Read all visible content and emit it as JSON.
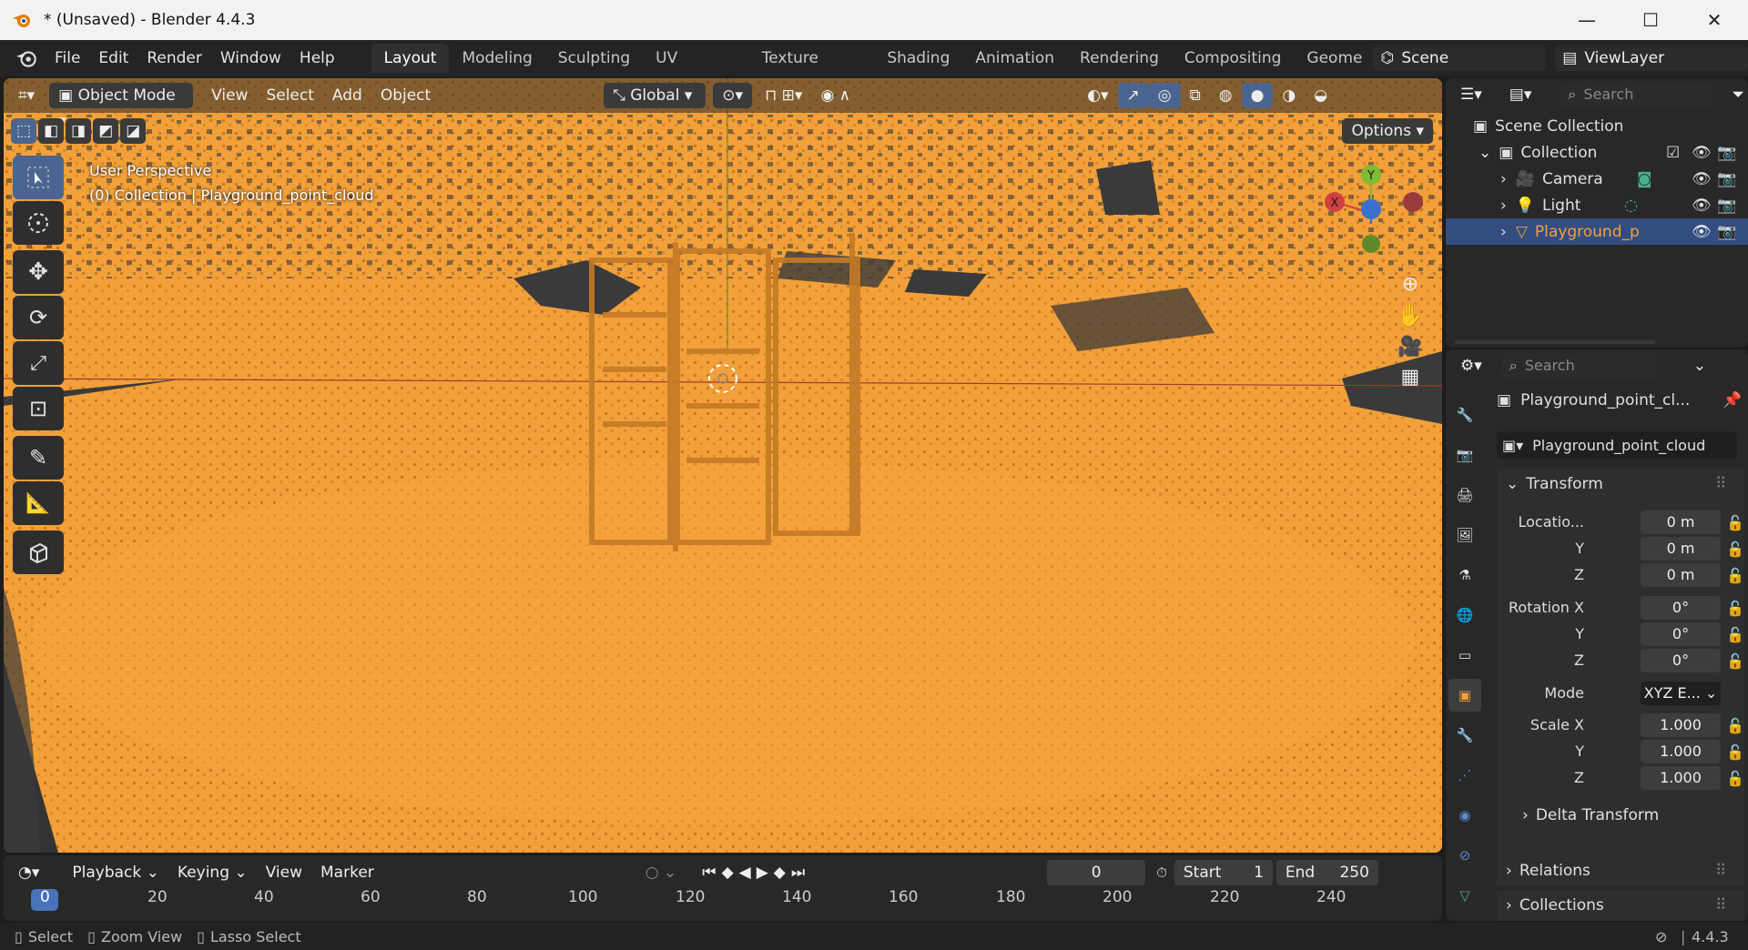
{
  "window": {
    "title": "* (Unsaved) - Blender 4.4.3"
  },
  "menu": [
    "File",
    "Edit",
    "Render",
    "Window",
    "Help"
  ],
  "workspaces": [
    "Layout",
    "Modeling",
    "Sculpting",
    "UV Editing",
    "Texture Paint",
    "Shading",
    "Animation",
    "Rendering",
    "Compositing",
    "Geome"
  ],
  "active_workspace": "Layout",
  "scene": {
    "name": "Scene",
    "view_layer": "ViewLayer"
  },
  "viewport": {
    "mode": "Object Mode",
    "menus": [
      "View",
      "Select",
      "Add",
      "Object"
    ],
    "orientation": "Global",
    "options_label": "Options",
    "overlay_line1": "User Perspective",
    "overlay_line2": "(0) Collection | Playground_point_cloud",
    "gizmo": {
      "x": "X",
      "y": "Y"
    }
  },
  "outliner": {
    "search_placeholder": "Search",
    "scene_collection": "Scene Collection",
    "collection": "Collection",
    "items": [
      {
        "name": "Camera",
        "icon": "camera-icon"
      },
      {
        "name": "Light",
        "icon": "light-icon"
      },
      {
        "name": "Playground_p",
        "icon": "mesh-icon",
        "selected": true
      }
    ]
  },
  "properties": {
    "search_placeholder": "Search",
    "object_name": "Playground_point_cl...",
    "data_name": "Playground_point_cloud",
    "transform_label": "Transform",
    "location_label": "Locatio...",
    "rotation_label": "Rotation X",
    "mode_label": "Mode",
    "scale_label": "Scale X",
    "y_label": "Y",
    "z_label": "Z",
    "location": [
      "0 m",
      "0 m",
      "0 m"
    ],
    "rotation": [
      "0°",
      "0°",
      "0°"
    ],
    "mode_value": "XYZ E...",
    "scale": [
      "1.000",
      "1.000",
      "1.000"
    ],
    "delta_transform": "Delta Transform",
    "relations": "Relations",
    "collections": "Collections"
  },
  "timeline": {
    "menus": [
      "Playback",
      "Keying",
      "View",
      "Marker"
    ],
    "current_frame": "0",
    "start_label": "Start",
    "start": "1",
    "end_label": "End",
    "end": "250",
    "ticks": [
      "0",
      "20",
      "40",
      "60",
      "80",
      "100",
      "120",
      "140",
      "160",
      "180",
      "200",
      "220",
      "240"
    ]
  },
  "status": {
    "select": "Select",
    "zoom": "Zoom View",
    "lasso": "Lasso Select",
    "version": "4.4.3"
  },
  "colors": {
    "accent": "#4a6690",
    "selection": "#f5a03a",
    "header": "#242424"
  }
}
